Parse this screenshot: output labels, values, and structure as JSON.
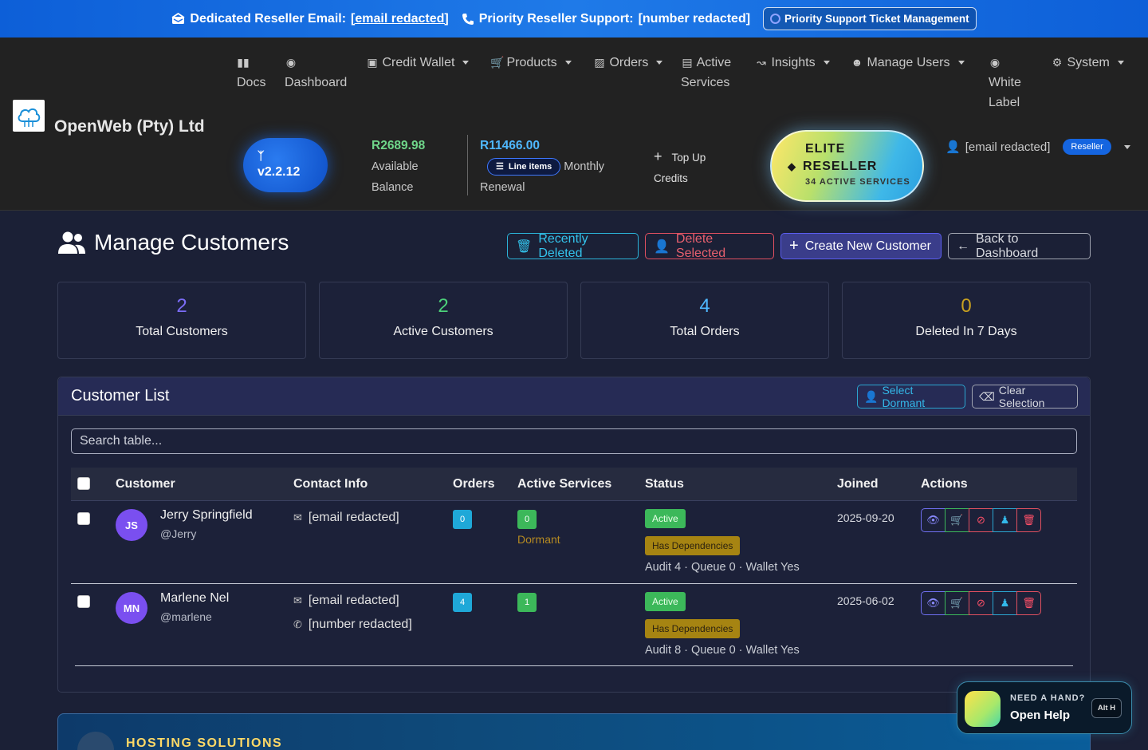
{
  "topbar": {
    "email_label": "Dedicated Reseller Email:",
    "email_value": "[email redacted]",
    "support_label": "Priority Reseller Support:",
    "support_value": "[number redacted]",
    "ticket_button": "Priority Support Ticket Management"
  },
  "brand": {
    "name": "OpenWeb (Pty) Ltd"
  },
  "nav": {
    "docs": "Docs",
    "dashboard": "Dashboard",
    "credit_wallet": "Credit Wallet",
    "products": "Products",
    "orders": "Orders",
    "active_services_1": "Active",
    "active_services_2": "Services",
    "insights": "Insights",
    "manage_users": "Manage Users",
    "white_label_1": "White",
    "white_label_2": "Label",
    "system": "System"
  },
  "version": "v2.2.12",
  "balance": {
    "amount": "R2689.98",
    "label_1": "Available",
    "label_2": "Balance"
  },
  "renewal": {
    "amount": "R11466.00",
    "line_items": "Line items",
    "label_1": "Monthly",
    "label_2": "Renewal"
  },
  "topup": {
    "label_1": "Top Up",
    "label_2": "Credits"
  },
  "elite": {
    "line1": "ELITE",
    "line2": "RESELLER",
    "line3": "34 ACTIVE SERVICES"
  },
  "user": {
    "email": "[email redacted]",
    "role_badge": "Reseller"
  },
  "page": {
    "title": "Manage Customers",
    "buttons": {
      "recently_deleted": "Recently Deleted",
      "delete_selected": "Delete Selected",
      "create_new": "Create New Customer",
      "back": "Back to Dashboard"
    }
  },
  "stats": [
    {
      "value": "2",
      "label": "Total Customers",
      "color": "#7b6cf6"
    },
    {
      "value": "2",
      "label": "Active Customers",
      "color": "#4cd07a"
    },
    {
      "value": "4",
      "label": "Total Orders",
      "color": "#4fb8ff"
    },
    {
      "value": "0",
      "label": "Deleted In 7 Days",
      "color": "#c8a020"
    }
  ],
  "customer_list": {
    "title": "Customer List",
    "select_dormant": "Select Dormant",
    "clear_selection": "Clear Selection",
    "search_placeholder": "Search table...",
    "columns": [
      "Customer",
      "Contact Info",
      "Orders",
      "Active Services",
      "Status",
      "Joined",
      "Actions"
    ],
    "rows": [
      {
        "initials": "JS",
        "name": "Jerry Springfield",
        "username": "@Jerry",
        "email": "[email redacted]",
        "phone": "",
        "orders": "0",
        "active_services": "0",
        "dormant": "Dormant",
        "status": "Active",
        "dependency": "Has Dependencies",
        "audit": "Audit 4 · Queue 0 · Wallet Yes",
        "joined": "2025-09-20"
      },
      {
        "initials": "MN",
        "name": "Marlene Nel",
        "username": "@marlene",
        "email": "[email redacted]",
        "phone": "[number redacted]",
        "orders": "4",
        "active_services": "1",
        "dormant": "",
        "status": "Active",
        "dependency": "Has Dependencies",
        "audit": "Audit 8 · Queue 0 · Wallet Yes",
        "joined": "2025-06-02"
      }
    ]
  },
  "hosting": {
    "title": "HOSTING SOLUTIONS"
  },
  "help": {
    "small": "NEED A HAND?",
    "big": "Open Help",
    "shortcut": "Alt H"
  }
}
